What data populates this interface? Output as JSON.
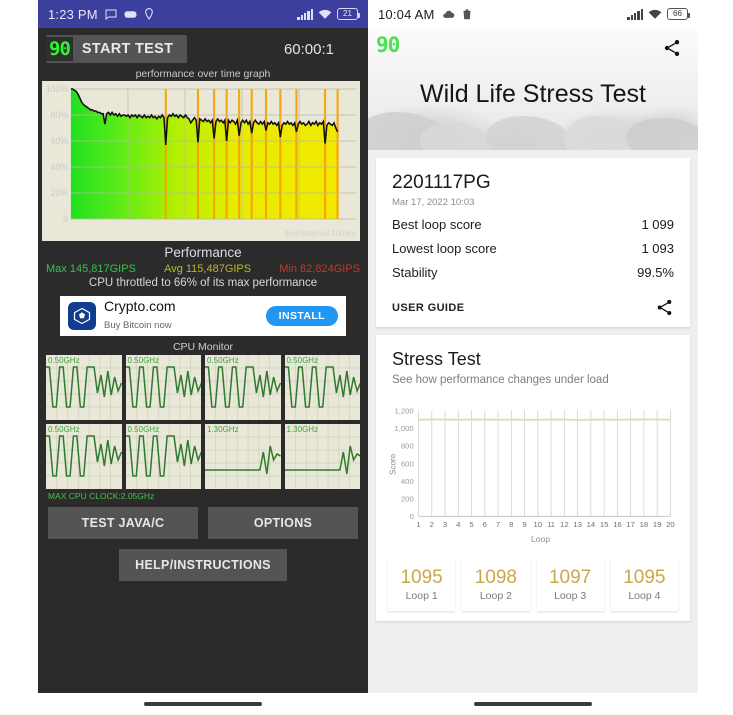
{
  "left_phone": {
    "status_bar": {
      "time": "1:23 PM",
      "icons": [
        "message-icon",
        "game-icon",
        "location-icon"
      ],
      "battery": "21",
      "signal_icon": "signal-bars-icon",
      "wifi_icon": "wifi-icon"
    },
    "app_logo": "90",
    "start_button": "START TEST",
    "timer": "60:00:1",
    "graph_caption": "performance over time graph",
    "x_axis_label": "time(interval 10min)",
    "y_ticks": [
      "100%",
      "80%",
      "60%",
      "40%",
      "20%",
      "0"
    ],
    "performance_heading": "Performance",
    "stats": {
      "max": "Max 145,817GIPS",
      "avg": "Avg 115,487GIPS",
      "min": "Min 82,824GIPS",
      "max_color": "#35c44a",
      "avg_color": "#b9b92e",
      "min_color": "#c0392b"
    },
    "throttle_note": "CPU throttled to 66% of its max performance",
    "ad": {
      "title": "Crypto.com",
      "subtitle": "Buy Bitcoin now",
      "button": "INSTALL"
    },
    "cpu_monitor_title": "CPU Monitor",
    "cores": [
      {
        "freq": "0.50GHz"
      },
      {
        "freq": "0.50GHz"
      },
      {
        "freq": "0.50GHz"
      },
      {
        "freq": "0.50GHz"
      },
      {
        "freq": "0.50GHz"
      },
      {
        "freq": "0.50GHz"
      },
      {
        "freq": "1.30GHz"
      },
      {
        "freq": "1.30GHz"
      }
    ],
    "max_cpu_clock": "MAX CPU CLOCK:2.05GHz",
    "buttons": {
      "test_java_c": "TEST JAVA/C",
      "options": "OPTIONS",
      "help": "HELP/INSTRUCTIONS"
    }
  },
  "right_phone": {
    "status_bar": {
      "time": "10:04 AM",
      "icons": [
        "cloud-icon",
        "trash-icon"
      ],
      "battery": "66",
      "signal_icon": "signal-bars-icon",
      "wifi_icon": "wifi-icon"
    },
    "overlay_logo": "90",
    "hero_title": "Wild Life Stress Test",
    "share_icon": "share-icon",
    "result_card": {
      "device": "2201117PG",
      "date": "Mar 17, 2022 10:03",
      "rows": [
        {
          "label": "Best loop score",
          "value": "1 099"
        },
        {
          "label": "Lowest loop score",
          "value": "1 093"
        },
        {
          "label": "Stability",
          "value": "99.5%"
        }
      ],
      "user_guide": "USER GUIDE",
      "share_icon": "share-icon"
    },
    "stress_card": {
      "title": "Stress Test",
      "subtitle": "See how performance changes under load"
    },
    "loop_cards": [
      {
        "score": "1095",
        "label": "Loop 1"
      },
      {
        "score": "1098",
        "label": "Loop 2"
      },
      {
        "score": "1097",
        "label": "Loop 3"
      },
      {
        "score": "1095",
        "label": "Loop 4"
      }
    ]
  },
  "chart_data": [
    {
      "type": "line",
      "title": "performance over time graph",
      "xlabel": "time(interval 10min)",
      "ylabel": "",
      "ylim": [
        0,
        100
      ],
      "ytick_labels": [
        "0",
        "20%",
        "40%",
        "60%",
        "80%",
        "100%"
      ],
      "yticks": [
        0,
        20,
        40,
        60,
        80,
        100
      ],
      "grid": true,
      "series_name": "performance %",
      "values": [
        100,
        100,
        99,
        98,
        96,
        93,
        90,
        88,
        87,
        86,
        85,
        84,
        84,
        83,
        83,
        82,
        82,
        81,
        81,
        73,
        81,
        82,
        80,
        82,
        80,
        81,
        79,
        81,
        79,
        80,
        80,
        79,
        80,
        78,
        80,
        79,
        80,
        78,
        80,
        79,
        78,
        80,
        78,
        79,
        78,
        80,
        78,
        79,
        77,
        79,
        78,
        80,
        78,
        57,
        78,
        80,
        79,
        81,
        79,
        80,
        78,
        80,
        79,
        78,
        80,
        78,
        77,
        74,
        76,
        78,
        76,
        59,
        77,
        76,
        75,
        77,
        75,
        76,
        74,
        76,
        62,
        75,
        77,
        75,
        76,
        74,
        76,
        60,
        76,
        74,
        76,
        75,
        73,
        76,
        64,
        74,
        76,
        74,
        76,
        73,
        75,
        66,
        74,
        76,
        74,
        73,
        75,
        73,
        75,
        68,
        74,
        73,
        75,
        73,
        74,
        72,
        74,
        63,
        72,
        74,
        73,
        75,
        73,
        74,
        72,
        74,
        67,
        73,
        75,
        73,
        74,
        72,
        73,
        75,
        72,
        74,
        73,
        75,
        72,
        74,
        73,
        75,
        58,
        72,
        74,
        73,
        72,
        74,
        70,
        67
      ],
      "fill_gradient": [
        "#2bdc2b",
        "#e8e800"
      ],
      "line_color": "#111111"
    },
    {
      "type": "line",
      "title": "Stress Test",
      "subtitle": "See how performance changes under load",
      "xlabel": "Loop",
      "ylabel": "Score",
      "ylim": [
        0,
        1200
      ],
      "yticks": [
        0,
        200,
        400,
        600,
        800,
        1000,
        1200
      ],
      "ytick_labels": [
        "0",
        "200",
        "400",
        "600",
        "800",
        "1,000",
        "1,200"
      ],
      "x": [
        1,
        2,
        3,
        4,
        5,
        6,
        7,
        8,
        9,
        10,
        11,
        12,
        13,
        14,
        15,
        16,
        17,
        18,
        19,
        20
      ],
      "xtick_labels": [
        "1",
        "2",
        "3",
        "4",
        "5",
        "6",
        "7",
        "8",
        "9",
        "10",
        "11",
        "12",
        "13",
        "14",
        "15",
        "16",
        "17",
        "18",
        "19",
        "20"
      ],
      "values": [
        1095,
        1098,
        1097,
        1095,
        1096,
        1097,
        1095,
        1096,
        1094,
        1095,
        1096,
        1097,
        1093,
        1095,
        1096,
        1094,
        1096,
        1099,
        1097,
        1095
      ],
      "grid": true,
      "line_color": "#e3d9c0",
      "legend": "none"
    },
    {
      "type": "line",
      "title": "CPU Monitor",
      "note": "8 per-core frequency sparklines",
      "series": [
        {
          "name": "core-1",
          "max_freq": "0.50GHz"
        },
        {
          "name": "core-2",
          "max_freq": "0.50GHz"
        },
        {
          "name": "core-3",
          "max_freq": "0.50GHz"
        },
        {
          "name": "core-4",
          "max_freq": "0.50GHz"
        },
        {
          "name": "core-5",
          "max_freq": "0.50GHz"
        },
        {
          "name": "core-6",
          "max_freq": "0.50GHz"
        },
        {
          "name": "core-7",
          "max_freq": "1.30GHz"
        },
        {
          "name": "core-8",
          "max_freq": "1.30GHz"
        }
      ],
      "line_color": "#2f7a2f"
    }
  ]
}
